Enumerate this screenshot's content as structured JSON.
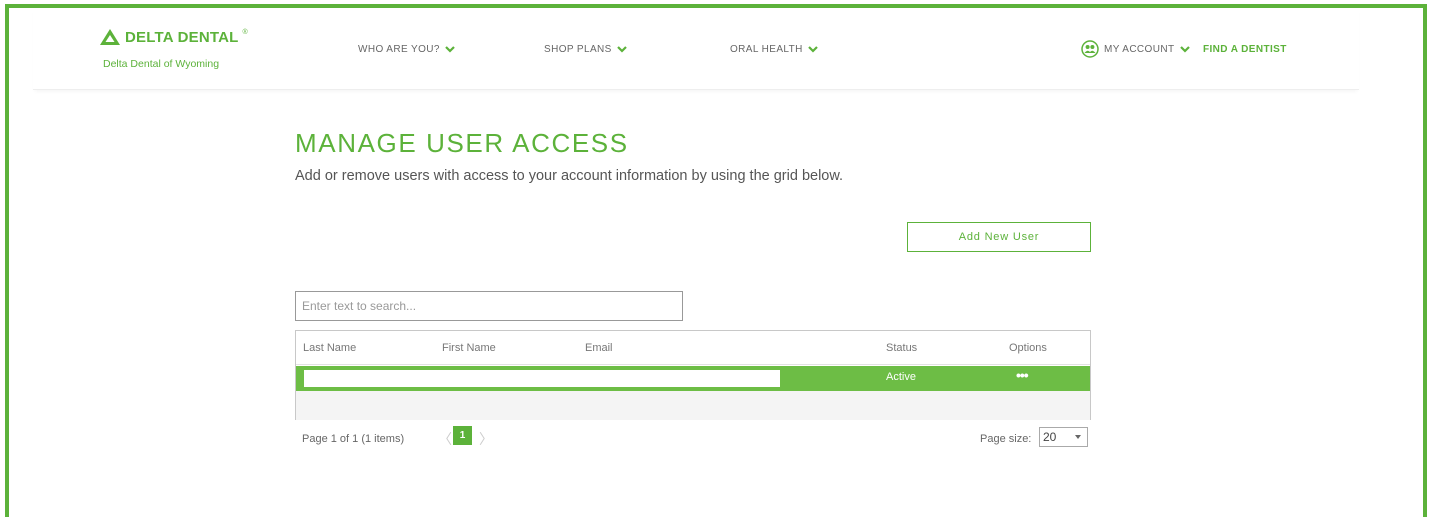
{
  "header": {
    "logo_text": "DELTA DENTAL",
    "logo_reg": "®",
    "logo_subtitle": "Delta Dental of Wyoming",
    "nav": {
      "who_are_you": "WHO ARE YOU?",
      "shop_plans": "SHOP PLANS",
      "oral_health": "ORAL HEALTH",
      "my_account": "MY ACCOUNT",
      "find_dentist": "FIND A DENTIST"
    }
  },
  "page": {
    "title": "MANAGE USER ACCESS",
    "description": "Add or remove users with access to your account information by using the grid below."
  },
  "actions": {
    "add_user_label": "Add New User"
  },
  "search": {
    "placeholder": "Enter text to search...",
    "value": ""
  },
  "grid": {
    "columns": [
      "Last Name",
      "First Name",
      "Email",
      "Status",
      "Options"
    ],
    "rows": [
      {
        "last_name": "",
        "first_name": "",
        "email": "",
        "status": "Active",
        "options": "•••"
      }
    ]
  },
  "pager": {
    "info": "Page 1 of 1 (1 items)",
    "prev": "〈",
    "current_page": "1",
    "next": "〉",
    "page_size_label": "Page size:",
    "page_size": "20"
  },
  "colors": {
    "brand_green": "#5cb23a",
    "row_highlight": "#6dbd45"
  },
  "icons": {
    "logo": "delta-triangle-logo",
    "dropdown": "chevron-down-icon",
    "account": "account-people-icon",
    "select": "caret-down-icon"
  }
}
